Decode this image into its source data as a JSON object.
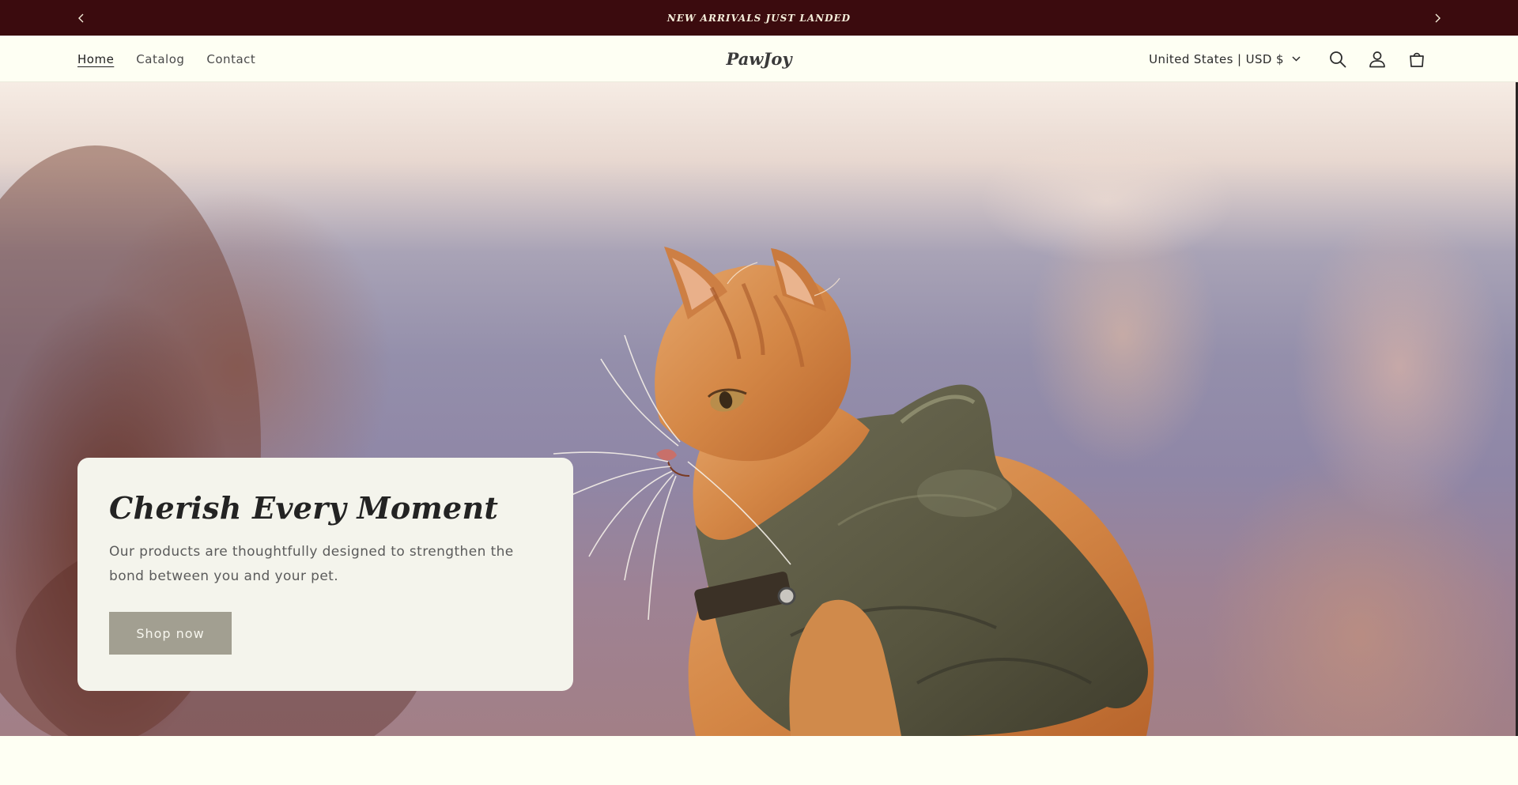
{
  "announcement": {
    "text": "NEW ARRIVALS JUST LANDED",
    "prev_icon": "chevron-left-icon",
    "next_icon": "chevron-right-icon"
  },
  "header": {
    "nav": [
      {
        "label": "Home",
        "active": true
      },
      {
        "label": "Catalog",
        "active": false
      },
      {
        "label": "Contact",
        "active": false
      }
    ],
    "logo": "PawJoy",
    "currency": "United States | USD $",
    "icons": [
      "search-icon",
      "account-icon",
      "cart-icon"
    ]
  },
  "hero": {
    "image": "orange cat wearing an olive puffer vest against a blurred canyon",
    "title": "Cherish Every Moment",
    "text": "Our products are thoughtfully designed to strengthen the bond between you and your pet.",
    "button": "Shop now"
  },
  "colors": {
    "announcement_bg": "#3b0b0e",
    "page_bg": "#fefff3",
    "card_bg": "#f4f4ec",
    "button_bg": "#a29f91"
  }
}
